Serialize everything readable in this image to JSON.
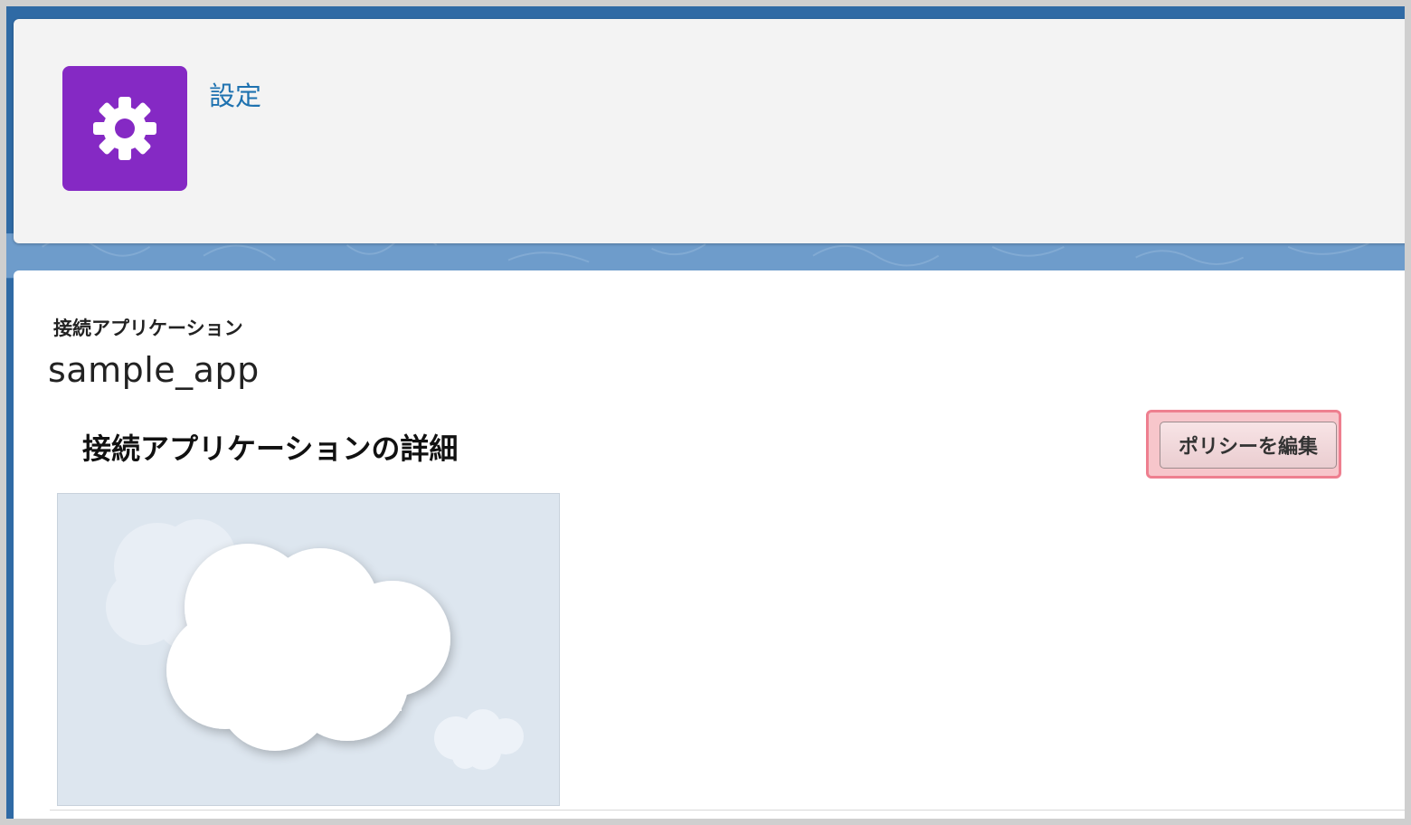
{
  "header": {
    "setup_link": "設定",
    "app_icon": "gear-icon",
    "app_icon_color": "#8529c4"
  },
  "content": {
    "subtitle": "接続アプリケーション",
    "title": "sample_app",
    "section_title": "接続アプリケーションの詳細",
    "edit_policy_button": "ポリシーを編集",
    "logo": "cloud-logo"
  },
  "colors": {
    "background_blue": "#2f6aa5",
    "link": "#1e72b0",
    "highlight": "#ee7f8f"
  }
}
